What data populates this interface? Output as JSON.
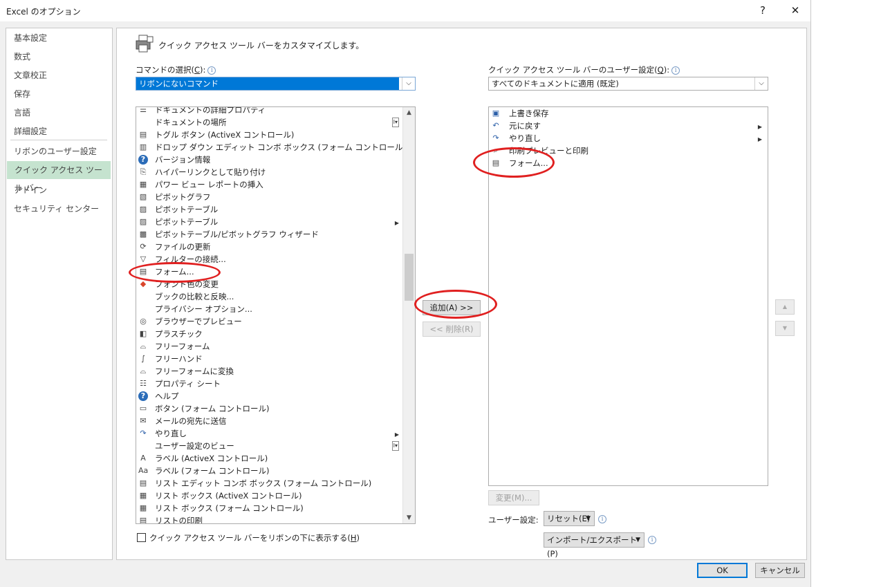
{
  "window": {
    "title": "Excel のオプション",
    "help_label": "?",
    "close_label": "✕"
  },
  "nav": {
    "items": [
      {
        "label": "基本設定"
      },
      {
        "label": "数式"
      },
      {
        "label": "文章校正"
      },
      {
        "label": "保存"
      },
      {
        "label": "言語"
      },
      {
        "label": "詳細設定"
      },
      {
        "label": "リボンのユーザー設定"
      },
      {
        "label": "クイック アクセス ツール バー",
        "selected": true
      },
      {
        "label": "アドイン"
      },
      {
        "label": "セキュリティ センター"
      }
    ]
  },
  "header": {
    "text": "クイック アクセス ツール バーをカスタマイズします。"
  },
  "left": {
    "choose_label_prefix": "コマンドの選択(",
    "choose_label_key": "C",
    "choose_label_suffix": "):",
    "combo_value": "リボンにないコマンド",
    "commands": [
      {
        "label": "ドキュメントの詳細プロパティ",
        "icon": "property-icon"
      },
      {
        "label": "ドキュメントの場所",
        "icon": "",
        "sub": "I-"
      },
      {
        "label": "トグル ボタン (ActiveX コントロール)",
        "icon": "toggle-icon"
      },
      {
        "label": "ドロップ ダウン エディット コンボ ボックス (フォーム コントロール)",
        "icon": "combo-icon"
      },
      {
        "label": "バージョン情報",
        "icon": "help-icon"
      },
      {
        "label": "ハイパーリンクとして貼り付け",
        "icon": "paste-link-icon"
      },
      {
        "label": "パワー ビュー レポートの挿入",
        "icon": "power-view-icon"
      },
      {
        "label": "ピボットグラフ",
        "icon": "pivot-chart-icon"
      },
      {
        "label": "ピボットテーブル",
        "icon": "pivot-table-icon"
      },
      {
        "label": "ピボットテーブル",
        "icon": "pivot-table-icon",
        "sub": ">"
      },
      {
        "label": "ピボットテーブル/ピボットグラフ ウィザード",
        "icon": "pivot-wizard-icon"
      },
      {
        "label": "ファイルの更新",
        "icon": "file-refresh-icon"
      },
      {
        "label": "フィルターの接続...",
        "icon": "filter-icon"
      },
      {
        "label": "フォーム...",
        "icon": "form-icon"
      },
      {
        "label": "フォント色の変更",
        "icon": "font-color-icon"
      },
      {
        "label": "ブックの比較と反映...",
        "icon": ""
      },
      {
        "label": "プライバシー オプション...",
        "icon": ""
      },
      {
        "label": "ブラウザーでプレビュー",
        "icon": "browser-preview-icon"
      },
      {
        "label": "プラスチック",
        "icon": "plastic-icon"
      },
      {
        "label": "フリーフォーム",
        "icon": "freeform-icon"
      },
      {
        "label": "フリーハンド",
        "icon": "freehand-icon"
      },
      {
        "label": "フリーフォームに変換",
        "icon": "freeform-convert-icon"
      },
      {
        "label": "プロパティ シート",
        "icon": "property-sheet-icon"
      },
      {
        "label": "ヘルプ",
        "icon": "help-icon"
      },
      {
        "label": "ボタン (フォーム コントロール)",
        "icon": "button-control-icon"
      },
      {
        "label": "メールの宛先に送信",
        "icon": "mail-icon"
      },
      {
        "label": "やり直し",
        "icon": "redo-icon",
        "sub": ">"
      },
      {
        "label": "ユーザー設定のビュー",
        "icon": "",
        "sub": "I-"
      },
      {
        "label": "ラベル (ActiveX コントロール)",
        "icon": "label-a-icon"
      },
      {
        "label": "ラベル (フォーム コントロール)",
        "icon": "label-aa-icon"
      },
      {
        "label": "リスト エディット コンボ ボックス (フォーム コントロール)",
        "icon": "list-combo-icon"
      },
      {
        "label": "リスト ボックス (ActiveX コントロール)",
        "icon": "list-box-icon"
      },
      {
        "label": "リスト ボックス (フォーム コントロール)",
        "icon": "list-box-icon"
      },
      {
        "label": "リストの印刷",
        "icon": "list-print-icon"
      }
    ],
    "show_below_label_prefix": "クイック アクセス ツール バーをリボンの下に表示する(",
    "show_below_label_key": "H",
    "show_below_label_suffix": ")"
  },
  "middle": {
    "add_label": "追加(A) >>",
    "remove_label": "<< 削除(R)"
  },
  "right": {
    "customize_label_prefix": "クイック アクセス ツール バーのユーザー設定(",
    "customize_label_key": "Q",
    "customize_label_suffix": "):",
    "combo_value": "すべてのドキュメントに適用 (既定)",
    "items": [
      {
        "label": "上書き保存",
        "icon": "save-icon"
      },
      {
        "label": "元に戻す",
        "icon": "undo-icon",
        "sub": ">"
      },
      {
        "label": "やり直し",
        "icon": "redo-icon",
        "sub": ">"
      },
      {
        "label": "印刷プレビューと印刷",
        "icon": "print-preview-icon"
      },
      {
        "label": "フォーム...",
        "icon": "form-icon"
      }
    ],
    "modify_label": "変更(M)...",
    "user_settings_label": "ユーザー設定:",
    "reset_label": "リセット(E)",
    "import_export_label": "インポート/エクスポート(P)"
  },
  "footer": {
    "ok_label": "OK",
    "cancel_label": "キャンセル"
  },
  "colors": {
    "accent": "#0078d7",
    "nav_selected": "#c5e3cf",
    "annotation": "#e02020"
  }
}
